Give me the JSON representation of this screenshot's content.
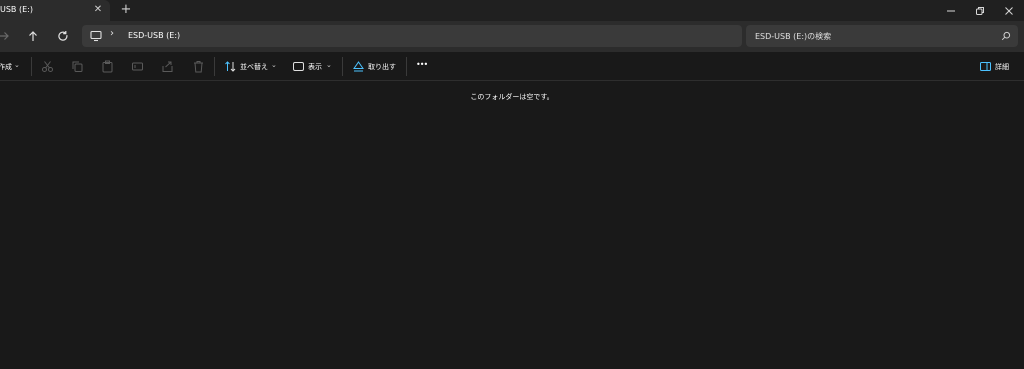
{
  "tab": {
    "title": "USB (E:)",
    "close_glyph": "✕"
  },
  "new_tab_glyph": "+",
  "window_controls": {
    "minimize": "—",
    "restore": "❐",
    "close": "✕"
  },
  "nav": {
    "back_icon": "arrow-right-icon",
    "up_icon": "arrow-up-icon",
    "refresh_icon": "refresh-icon"
  },
  "address": {
    "separator": "›",
    "location": "ESD-USB (E:)"
  },
  "search": {
    "placeholder": "ESD-USB (E:)の検索"
  },
  "toolbar": {
    "new_label": "作成",
    "sort_label": "並べ替え",
    "view_label": "表示",
    "eject_label": "取り出す",
    "details_label": "詳細",
    "more_glyph": "•••",
    "chevron": "⌄"
  },
  "main": {
    "empty_message": "このフォルダーは空です。"
  },
  "colors": {
    "background": "#191919",
    "tab_active": "#2c2c2c",
    "field": "#3a3a3a",
    "accent_blue": "#4cc2ff",
    "disabled_icon": "#5a5a5a"
  }
}
